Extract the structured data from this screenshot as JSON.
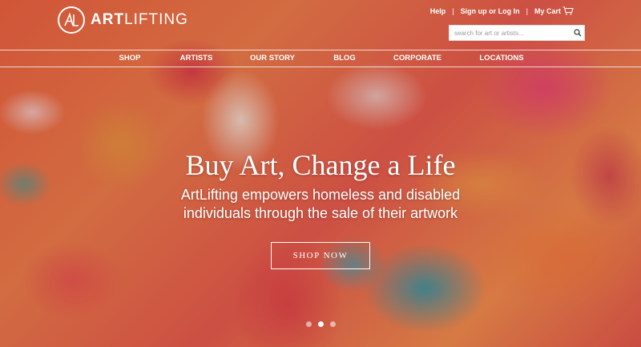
{
  "brand": {
    "logo_mark": "AL",
    "name_bold": "ART",
    "name_light": "LIFTING"
  },
  "utility": {
    "help": "Help",
    "signup_login": "Sign up or Log In",
    "cart": "My Cart",
    "separator": "|"
  },
  "search": {
    "placeholder": "search for art or artists..."
  },
  "nav": {
    "items": [
      "SHOP",
      "ARTISTS",
      "OUR STORY",
      "BLOG",
      "CORPORATE",
      "LOCATIONS"
    ]
  },
  "hero": {
    "headline": "Buy Art, Change a Life",
    "subheadline": "ArtLifting empowers homeless and disabled individuals through the sale of their artwork",
    "cta": "SHOP NOW"
  },
  "carousel": {
    "slide_count": 3,
    "active_index": 1
  },
  "icons": {
    "search": "search-icon",
    "cart": "cart-icon"
  },
  "colors": {
    "text": "#ffffff"
  }
}
